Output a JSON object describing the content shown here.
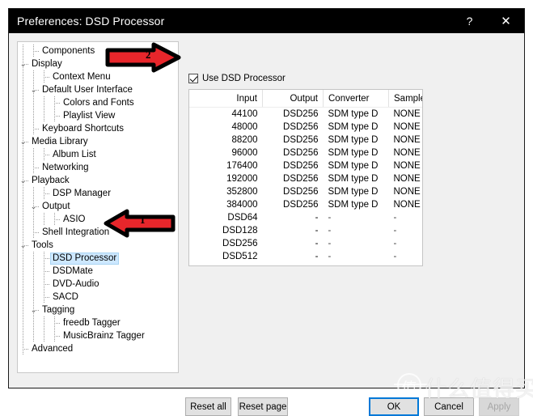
{
  "window": {
    "title": "Preferences: DSD Processor",
    "help_button": "?",
    "close_button": "✕"
  },
  "sidebar": {
    "items": [
      {
        "label": "Components",
        "depth": 1,
        "expander": "",
        "selected": false
      },
      {
        "label": "Display",
        "depth": 0,
        "expander": "⌄",
        "selected": false
      },
      {
        "label": "Context Menu",
        "depth": 2,
        "expander": "",
        "selected": false
      },
      {
        "label": "Default User Interface",
        "depth": 1,
        "expander": "⌄",
        "selected": false
      },
      {
        "label": "Colors and Fonts",
        "depth": 3,
        "expander": "",
        "selected": false
      },
      {
        "label": "Playlist View",
        "depth": 3,
        "expander": "",
        "selected": false
      },
      {
        "label": "Keyboard Shortcuts",
        "depth": 1,
        "expander": "",
        "selected": false
      },
      {
        "label": "Media Library",
        "depth": 0,
        "expander": "⌄",
        "selected": false
      },
      {
        "label": "Album List",
        "depth": 2,
        "expander": "",
        "selected": false
      },
      {
        "label": "Networking",
        "depth": 1,
        "expander": "",
        "selected": false
      },
      {
        "label": "Playback",
        "depth": 0,
        "expander": "⌄",
        "selected": false
      },
      {
        "label": "DSP Manager",
        "depth": 2,
        "expander": "",
        "selected": false
      },
      {
        "label": "Output",
        "depth": 1,
        "expander": "⌄",
        "selected": false
      },
      {
        "label": "ASIO",
        "depth": 3,
        "expander": "",
        "selected": false
      },
      {
        "label": "Shell Integration",
        "depth": 1,
        "expander": "",
        "selected": false
      },
      {
        "label": "Tools",
        "depth": 0,
        "expander": "⌄",
        "selected": false
      },
      {
        "label": "DSD Processor",
        "depth": 2,
        "expander": "",
        "selected": true
      },
      {
        "label": "DSDMate",
        "depth": 2,
        "expander": "",
        "selected": false
      },
      {
        "label": "DVD-Audio",
        "depth": 2,
        "expander": "",
        "selected": false
      },
      {
        "label": "SACD",
        "depth": 2,
        "expander": "",
        "selected": false
      },
      {
        "label": "Tagging",
        "depth": 1,
        "expander": "⌄",
        "selected": false
      },
      {
        "label": "freedb Tagger",
        "depth": 3,
        "expander": "",
        "selected": false
      },
      {
        "label": "MusicBrainz Tagger",
        "depth": 3,
        "expander": "",
        "selected": false
      },
      {
        "label": "Advanced",
        "depth": 0,
        "expander": "",
        "selected": false
      }
    ]
  },
  "main": {
    "use_dsd_processor_label": "Use DSD Processor",
    "use_dsd_processor_checked": true,
    "table": {
      "columns": [
        "Input",
        "Output",
        "Converter",
        "Sample&Hold"
      ],
      "rows": [
        {
          "input": "44100",
          "output": "DSD256",
          "converter": "SDM type D",
          "sample_hold": "NONE"
        },
        {
          "input": "48000",
          "output": "DSD256",
          "converter": "SDM type D",
          "sample_hold": "NONE"
        },
        {
          "input": "88200",
          "output": "DSD256",
          "converter": "SDM type D",
          "sample_hold": "NONE"
        },
        {
          "input": "96000",
          "output": "DSD256",
          "converter": "SDM type D",
          "sample_hold": "NONE"
        },
        {
          "input": "176400",
          "output": "DSD256",
          "converter": "SDM type D",
          "sample_hold": "NONE"
        },
        {
          "input": "192000",
          "output": "DSD256",
          "converter": "SDM type D",
          "sample_hold": "NONE"
        },
        {
          "input": "352800",
          "output": "DSD256",
          "converter": "SDM type D",
          "sample_hold": "NONE"
        },
        {
          "input": "384000",
          "output": "DSD256",
          "converter": "SDM type D",
          "sample_hold": "NONE"
        },
        {
          "input": "DSD64",
          "output": "-",
          "converter": "-",
          "sample_hold": "-"
        },
        {
          "input": "DSD128",
          "output": "-",
          "converter": "-",
          "sample_hold": "-"
        },
        {
          "input": "DSD256",
          "output": "-",
          "converter": "-",
          "sample_hold": "-"
        },
        {
          "input": "DSD512",
          "output": "-",
          "converter": "-",
          "sample_hold": "-"
        }
      ]
    }
  },
  "footer": {
    "reset_all": "Reset all",
    "reset_page": "Reset page",
    "ok": "OK",
    "cancel": "Cancel",
    "apply": "Apply"
  },
  "annotations": {
    "arrow_two": "2",
    "arrow_one": "1",
    "arrow_color": "#e8262b"
  },
  "watermark": {
    "logo_char": "值",
    "text": "什么值得买"
  }
}
